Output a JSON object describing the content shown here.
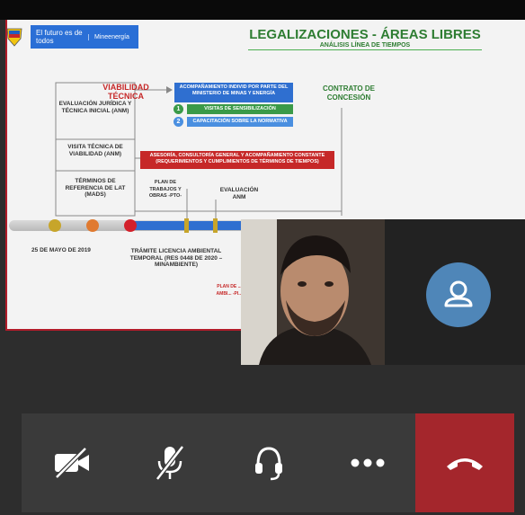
{
  "slide": {
    "gov_text": "El futuro es de todos",
    "ministry": "Mineenergía",
    "title": "LEGALIZACIONES - ÁREAS LIBRES",
    "subtitle": "ANÁLISIS LÍNEA DE TIEMPOS",
    "viabilidad": "VIABILIDAD TÉCNICA",
    "contrato": "CONTRATO DE CONCESIÓN",
    "eval_juridica": "EVALUACIÓN JURÍDICA Y TÉCNICA INICIAL (ANM)",
    "visita": "VISITA TÉCNICA DE VIABILIDAD (ANM)",
    "terminos": "TÉRMINOS DE REFERENCIA DE LAT (MADS)",
    "acompanamiento": "ACOMPAÑAMIENTO INDIVID POR PARTE DEL MINISTERIO DE MINAS Y ENERGÍA",
    "step1": "VISITAS DE SENSIBILIZACIÓN",
    "step2": "CAPACITACIÓN SOBRE LA NORMATIVA",
    "asesoria": "ASESORÍA, CONSULTORÍA GENERAL Y ACOMPAÑAMIENTO CONSTANTE (REQUERIMIENTOS Y CUMPLIMIENTOS DE TÉRMINOS DE TIEMPOS)",
    "plan_trabajos": "PLAN DE TRABAJOS Y OBRAS -PTO-",
    "evaluacion_anm": "EVALUACIÓN ANM",
    "fecha": "25 DE MAYO DE 2019",
    "tramite": "TRÁMITE LICENCIA AMBIENTAL TEMPORAL (RES 0448 DE 2020 – MINAMBIENTE)",
    "plan_amb": "PLAN DE ... AMBI... -PI..."
  },
  "controls": {
    "camera": "camera-off",
    "mic": "mic-off",
    "audio": "headset",
    "more": "more",
    "hangup": "hang-up"
  },
  "colors": {
    "accent_green": "#2e7d32",
    "blue": "#2f6fd0",
    "red": "#c62828",
    "hangup": "#a4262c",
    "avatar": "#4f86b8"
  }
}
